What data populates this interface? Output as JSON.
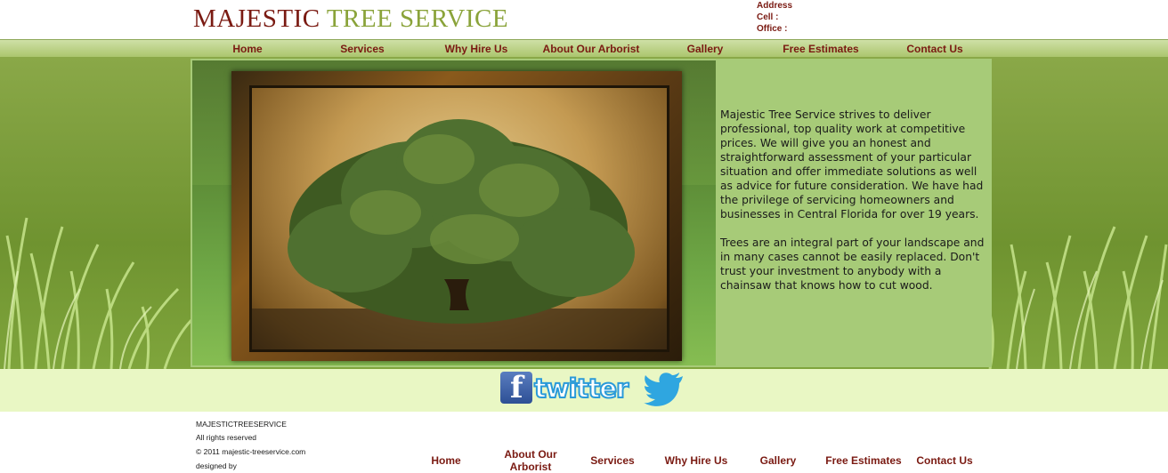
{
  "header": {
    "logo_word1": "MAJESTIC",
    "logo_word2": "TREE SERVICE",
    "address_label": "Address",
    "cell_label": "Cell :",
    "office_label": "Office :"
  },
  "nav": [
    {
      "label": "Home"
    },
    {
      "label": "Services"
    },
    {
      "label": "Why Hire Us"
    },
    {
      "label": "About Our Arborist"
    },
    {
      "label": "Gallery"
    },
    {
      "label": "Free Estimates"
    },
    {
      "label": "Contact Us"
    }
  ],
  "main": {
    "paragraph1": "Majestic Tree Service strives to deliver professional, top quality work at competitive prices. We will give you an honest and straightforward assessment of your particular situation and offer immediate solutions as well as advice for future consideration. We have had the privilege of servicing homeowners and businesses in Central Florida for over 19 years.",
    "paragraph2": "Trees are an integral part of your landscape and in many cases cannot be easily replaced. Don't trust your investment to anybody with a chainsaw that knows how to cut wood."
  },
  "social": {
    "facebook_letter": "f",
    "twitter_word": "twitter"
  },
  "footer": {
    "company": "MAJESTICTREESERVICE",
    "rights": "All rights reserved",
    "copyright": "© 2011 majestic-treeservice.com",
    "designed_by": "designed by",
    "nav": [
      {
        "label": "Home"
      },
      {
        "label": "About Our Arborist"
      },
      {
        "label": "Services"
      },
      {
        "label": "Why Hire Us"
      },
      {
        "label": "Gallery"
      },
      {
        "label": "Free Estimates"
      },
      {
        "label": "Contact Us"
      }
    ]
  },
  "colors": {
    "brand_dark_red": "#7a1a12",
    "brand_green": "#8aa33a",
    "content_panel": "#a7cb78",
    "social_band": "#e9f7c4"
  }
}
